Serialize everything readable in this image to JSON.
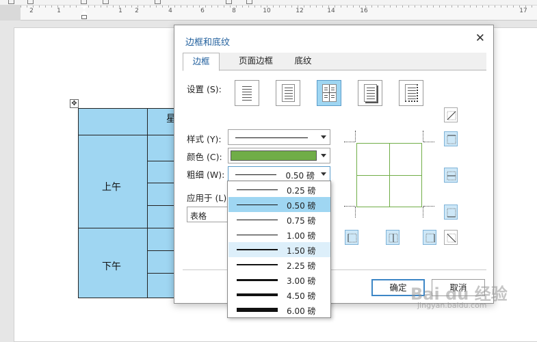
{
  "ruler": {
    "numbers": [
      "2",
      "1",
      "1",
      "2",
      "4",
      "6",
      "8",
      "10",
      "12",
      "14",
      "16",
      "17"
    ]
  },
  "document": {
    "table": {
      "header_fragment": "星",
      "morning": "上午",
      "afternoon": "下午"
    }
  },
  "dialog": {
    "title": "边框和底纹",
    "tabs": [
      "边框",
      "页面边框",
      "底纹"
    ],
    "active_tab": "边框",
    "settings_label": "设置 (S):",
    "settings_icons": [
      "box-none-icon",
      "box-frame-icon",
      "box-grid-icon",
      "box-shadow-icon",
      "box-custom-icon"
    ],
    "selected_setting": "box-grid-icon",
    "style_label": "样式 (Y):",
    "color_label": "颜色 (C):",
    "color_value": "#70ad47",
    "width_label": "粗细 (W):",
    "width_value": "0.50 磅",
    "apply_label": "应用于 (L)",
    "apply_value": "表格",
    "ok_label": "确定",
    "cancel_label": "取消"
  },
  "width_options": [
    {
      "label": "0.25 磅"
    },
    {
      "label": "0.50 磅",
      "selected": true
    },
    {
      "label": "0.75 磅"
    },
    {
      "label": "1.00 磅"
    },
    {
      "label": "1.50 磅",
      "hover": true
    },
    {
      "label": "2.25 磅"
    },
    {
      "label": "3.00 磅"
    },
    {
      "label": "4.50 磅"
    },
    {
      "label": "6.00 磅"
    }
  ],
  "watermark": {
    "text": "Bai du 经验",
    "sub": "jingyan.baidu.com"
  }
}
